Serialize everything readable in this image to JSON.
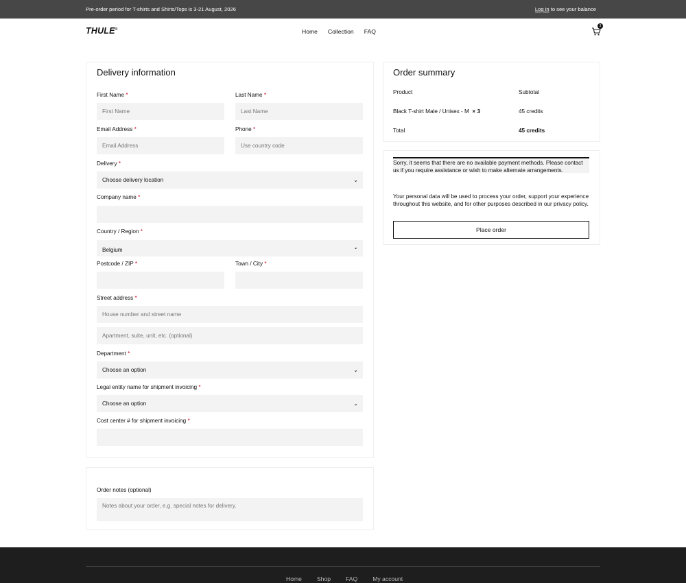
{
  "topbar": {
    "promo": "Pre-order period for T-shirts and Shirts/Tops is 3-21 August, 2026",
    "login_link": "Log in",
    "login_suffix": " to see your balance"
  },
  "header": {
    "logo": "THULE",
    "nav": [
      "Home",
      "Collection",
      "FAQ"
    ],
    "cart_count": "3"
  },
  "delivery": {
    "title": "Delivery information",
    "fields": {
      "first_name": {
        "label": "First Name",
        "placeholder": "First Name"
      },
      "last_name": {
        "label": "Last Name",
        "placeholder": "Last Name"
      },
      "email": {
        "label": "Email Address",
        "placeholder": "Email Address"
      },
      "phone": {
        "label": "Phone",
        "placeholder": "Use country code"
      },
      "delivery": {
        "label": "Delivery",
        "value": "Choose delivery location"
      },
      "company": {
        "label": "Company name",
        "value": ""
      },
      "country": {
        "label": "Country / Region",
        "value": "Belgium"
      },
      "postcode": {
        "label": "Postcode / ZIP",
        "value": ""
      },
      "town": {
        "label": "Town / City",
        "value": ""
      },
      "street": {
        "label": "Street address",
        "placeholder": "House number and street name",
        "placeholder2": "Apartment, suite, unit, etc. (optional)"
      },
      "department": {
        "label": "Department",
        "value": "Choose an option"
      },
      "legal_entity": {
        "label": "Legal entity name for shipment invoicing",
        "value": "Choose an option"
      },
      "cost_center": {
        "label": "Cost center # for shipment invoicing",
        "value": ""
      }
    }
  },
  "notes": {
    "label": "Order notes (optional)",
    "placeholder": "Notes about your order, e.g. special notes for delivery."
  },
  "summary": {
    "title": "Order summary",
    "col_product": "Product",
    "col_subtotal": "Subtotal",
    "item_name": "Black T-shirt Male / Unisex - M",
    "item_qty": "× 3",
    "item_subtotal": "45 credits",
    "total_label": "Total",
    "total_value": "45 credits"
  },
  "payment": {
    "notice": "Sorry, it seems that there are no available payment methods. Please contact us if you require assistance or wish to make alternate arrangements.",
    "privacy": "Your personal data will be used to process your order, support your experience throughout this website, and for other purposes described in our privacy policy.",
    "place_order": "Place order"
  },
  "footer": {
    "nav": [
      "Home",
      "Shop",
      "FAQ",
      "My account"
    ]
  },
  "colors": {
    "topbar": "#474747",
    "footer": "#1e1e1e",
    "required": "#d0021b",
    "field_bg": "#f3f3f3"
  },
  "icons": [
    "cart-icon",
    "chevron-down-icon"
  ]
}
